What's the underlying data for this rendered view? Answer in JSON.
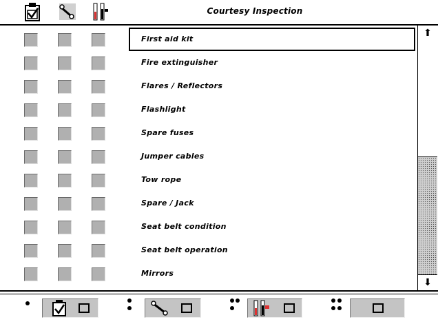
{
  "header": {
    "title": "Courtesy Inspection",
    "icons": [
      "clipboard-check-icon",
      "wrench-icon",
      "gauge-icon"
    ]
  },
  "items": [
    {
      "label": "First aid kit",
      "selected": true
    },
    {
      "label": "Fire extinguisher",
      "selected": false
    },
    {
      "label": "Flares / Reflectors",
      "selected": false
    },
    {
      "label": "Flashlight",
      "selected": false
    },
    {
      "label": "Spare fuses",
      "selected": false
    },
    {
      "label": "Jumper cables",
      "selected": false
    },
    {
      "label": "Tow rope",
      "selected": false
    },
    {
      "label": "Spare / Jack",
      "selected": false
    },
    {
      "label": "Seat belt condition",
      "selected": false
    },
    {
      "label": "Seat belt operation",
      "selected": false
    },
    {
      "label": "Mirrors",
      "selected": false
    }
  ],
  "scrollbar": {
    "up_glyph": "⬆",
    "down_glyph": "⬇"
  },
  "footer": {
    "tabs": [
      {
        "dots": 1,
        "icon": "clipboard-check-icon"
      },
      {
        "dots": 2,
        "icon": "wrench-icon"
      },
      {
        "dots": 3,
        "icon": "gauge-icon"
      },
      {
        "dots": 4,
        "icon": "none"
      }
    ]
  },
  "colors": {
    "checkbox": "#b0b0b0",
    "tab": "#c4c4c4",
    "track": "#cfcfcf"
  }
}
